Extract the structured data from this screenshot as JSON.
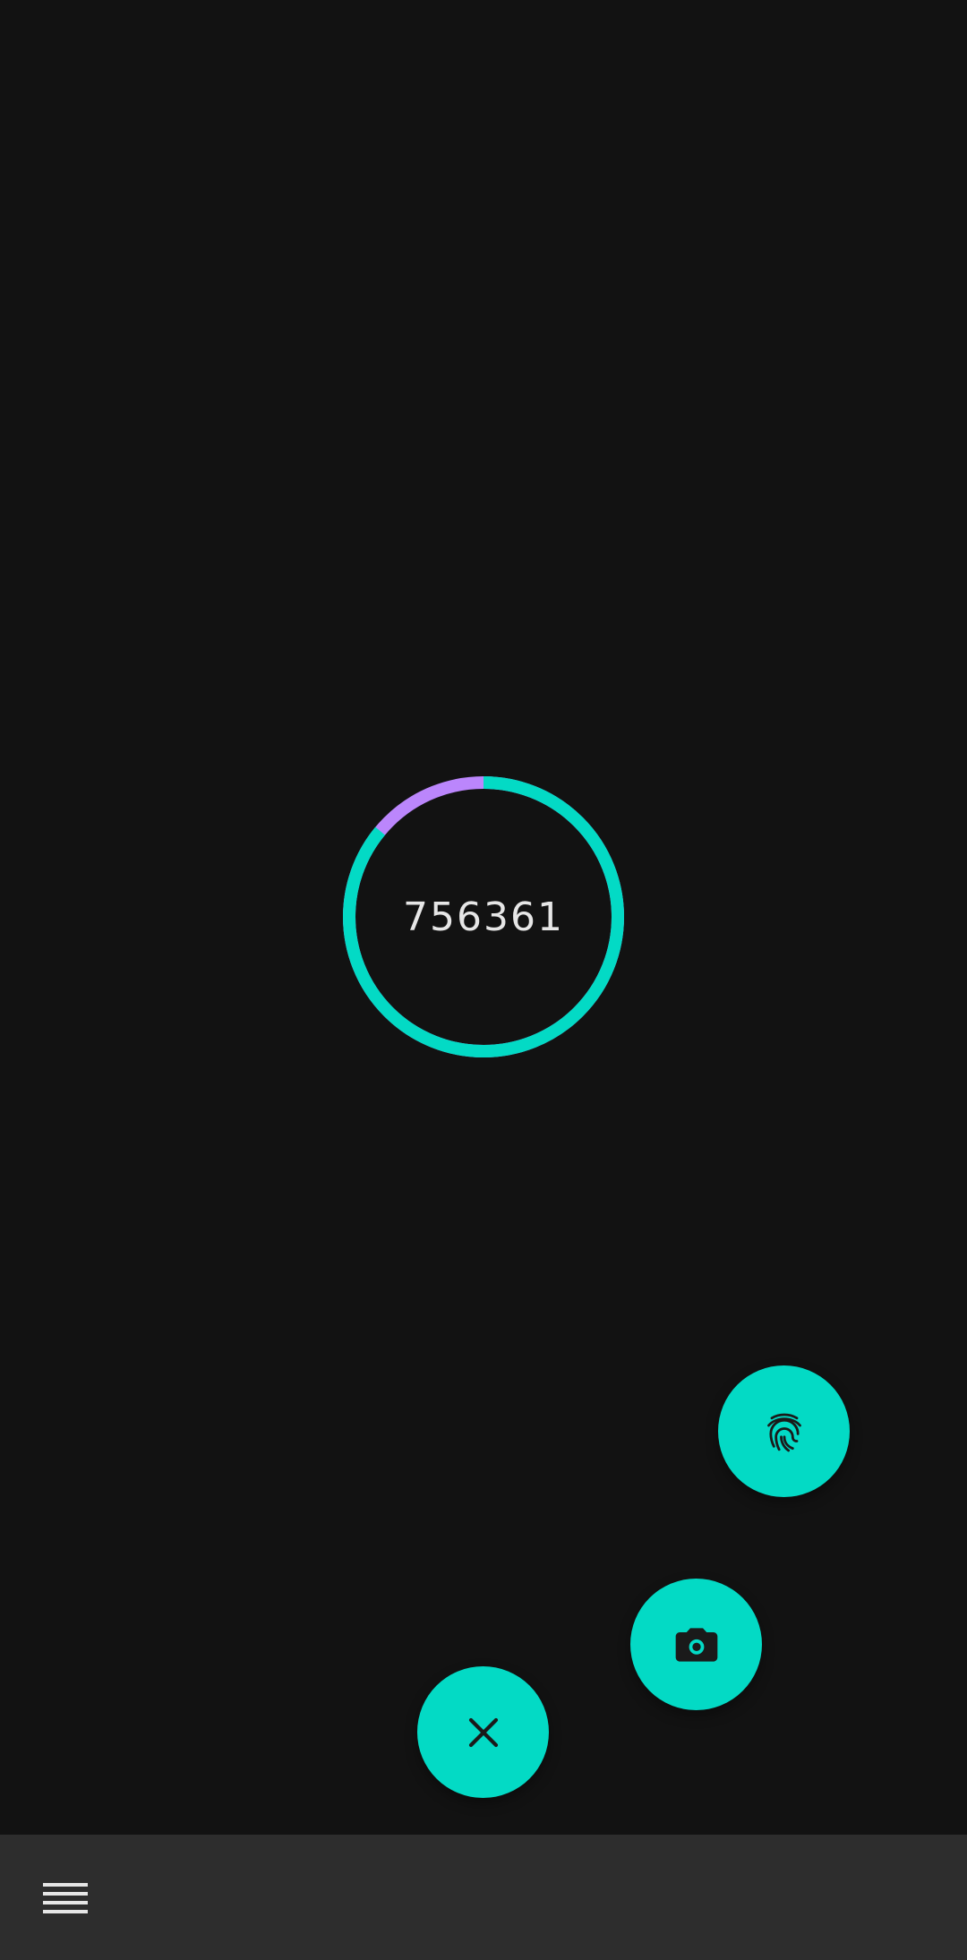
{
  "otp": {
    "code": "756361",
    "remaining_fraction": 0.86,
    "colors": {
      "remaining": "#03dac5",
      "elapsed": "#bb86fc"
    }
  },
  "fab_menu": {
    "color": "#03dac5",
    "items": [
      {
        "icon": "fingerprint-icon"
      },
      {
        "icon": "camera-icon"
      },
      {
        "icon": "close-icon"
      }
    ]
  },
  "bottom_bar": {
    "background": "#2d2d2d",
    "menu_icon": "hamburger-menu-icon"
  }
}
